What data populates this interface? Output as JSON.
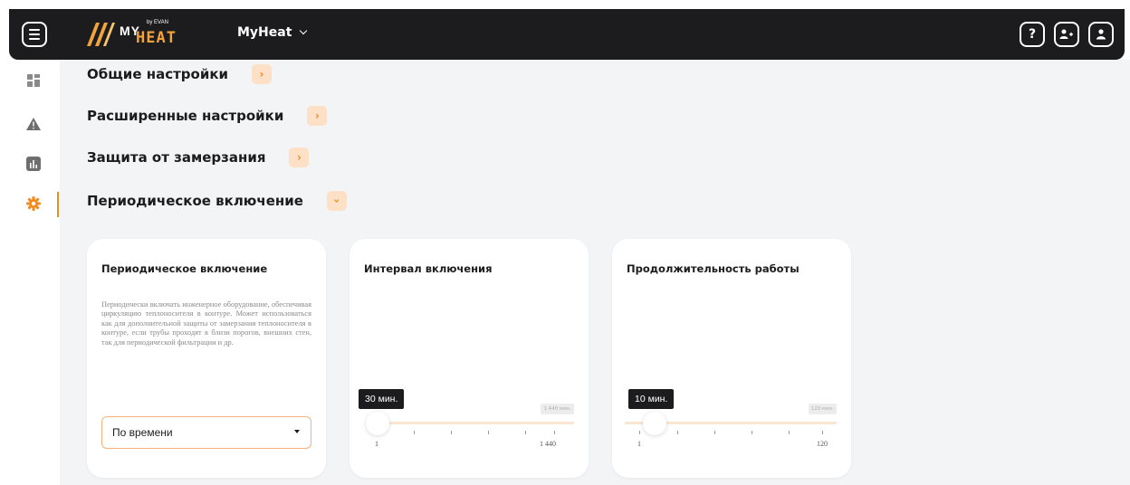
{
  "header": {
    "logo": {
      "my": "MY",
      "heat": "HEAT",
      "brand": "by EVAN"
    },
    "app_selector": "MyHeat",
    "icons": [
      "menu-icon",
      "help-icon",
      "add-user-icon",
      "user-icon"
    ],
    "help_label": "?"
  },
  "sidebar": {
    "items": [
      {
        "icon": "dashboard-icon",
        "active": false
      },
      {
        "icon": "alert-icon",
        "active": false
      },
      {
        "icon": "stats-icon",
        "active": false
      },
      {
        "icon": "settings-icon",
        "active": true
      }
    ]
  },
  "sections": [
    {
      "title": "Общие настройки",
      "expanded": false
    },
    {
      "title": "Расширенные настройки",
      "expanded": false
    },
    {
      "title": "Защита от замерзания",
      "expanded": false
    },
    {
      "title": "Периодическое включение",
      "expanded": true
    }
  ],
  "cards": {
    "periodic": {
      "title": "Периодическое включение",
      "description": "Периодически включать инженерное оборудование, обеспечивая циркуляцию теплоносителя в контуре. Может использоваться как для дополнительной защиты от замерзания теплоносителя в контуре, если трубы проходят в близи порогов, внешних стен, так для периодической фильтрации и др.",
      "select_value": "По времени"
    },
    "interval": {
      "title": "Интервал включения",
      "value_label": "30 мин.",
      "max_chip": "1 440 мин.",
      "min_label": "1",
      "max_label": "1 440",
      "value": 30,
      "min": 1,
      "max": 1440
    },
    "duration": {
      "title": "Продолжительность работы",
      "value_label": "10 мин.",
      "max_chip": "120 мин.",
      "min_label": "1",
      "max_label": "120",
      "value": 10,
      "min": 1,
      "max": 120
    }
  },
  "colors": {
    "accent": "#f28a1e",
    "accent_light": "#fde0c6",
    "topbar": "#1c1c1e",
    "background": "#f3f4f6"
  }
}
